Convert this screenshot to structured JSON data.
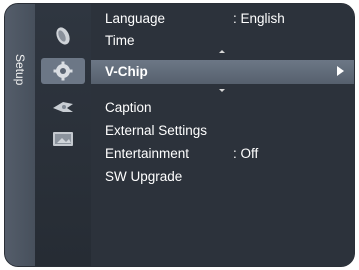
{
  "side_tab": {
    "label": "Setup"
  },
  "icons": [
    {
      "name": "satellite-dish-icon"
    },
    {
      "name": "gear-icon"
    },
    {
      "name": "channel-icon"
    },
    {
      "name": "picture-icon"
    }
  ],
  "menu": {
    "items": [
      {
        "label": "Language",
        "value": ": English"
      },
      {
        "label": "Time",
        "value": ""
      },
      {
        "label": "V-Chip",
        "value": "",
        "selected": true
      },
      {
        "label": "Caption",
        "value": ""
      },
      {
        "label": "External Settings",
        "value": ""
      },
      {
        "label": "Entertainment",
        "value": ": Off"
      },
      {
        "label": "SW Upgrade",
        "value": ""
      }
    ]
  },
  "colors": {
    "selection": "#6c7786",
    "panel": "#2c323b"
  }
}
